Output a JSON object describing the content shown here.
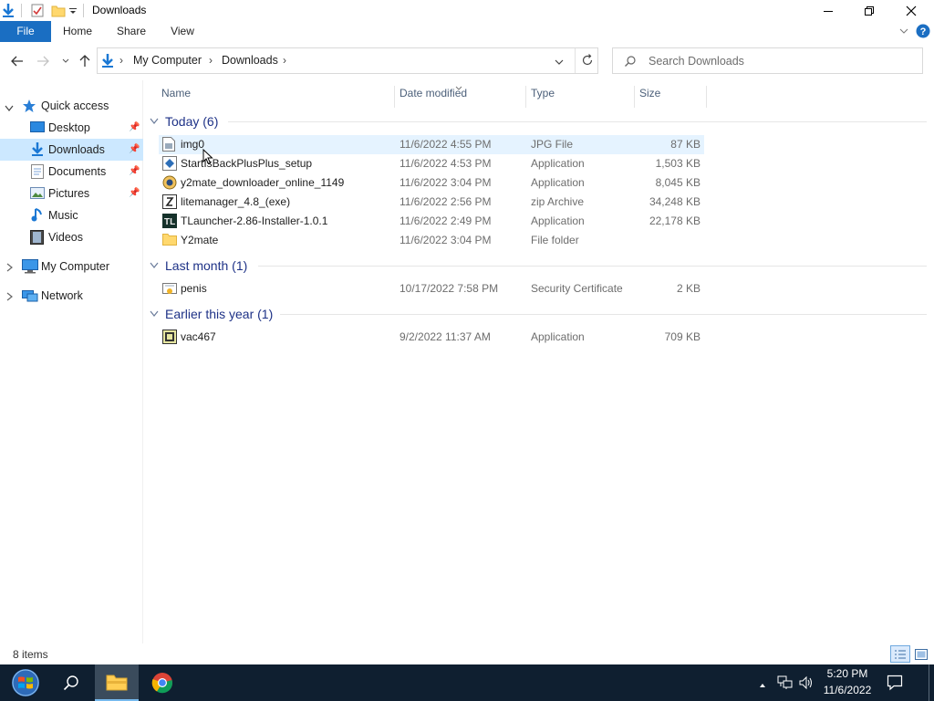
{
  "window": {
    "title": "Downloads"
  },
  "ribbon": {
    "tabs": [
      "File",
      "Home",
      "Share",
      "View"
    ]
  },
  "address": {
    "crumbs": [
      "My Computer",
      "Downloads"
    ],
    "search_placeholder": "Search Downloads"
  },
  "nav": {
    "quick_access": "Quick access",
    "items": [
      "Desktop",
      "Downloads",
      "Documents",
      "Pictures",
      "Music",
      "Videos"
    ],
    "my_computer": "My Computer",
    "network": "Network"
  },
  "columns": [
    "Name",
    "Date modified",
    "Type",
    "Size"
  ],
  "groups": [
    {
      "label": "Today (6)"
    },
    {
      "label": "Last month (1)"
    },
    {
      "label": "Earlier this year (1)"
    }
  ],
  "files": [
    {
      "name": "img0",
      "date": "11/6/2022 4:55 PM",
      "type": "JPG File",
      "size": "87 KB"
    },
    {
      "name": "StartIsBackPlusPlus_setup",
      "date": "11/6/2022 4:53 PM",
      "type": "Application",
      "size": "1,503 KB"
    },
    {
      "name": "y2mate_downloader_online_1149",
      "date": "11/6/2022 3:04 PM",
      "type": "Application",
      "size": "8,045 KB"
    },
    {
      "name": "litemanager_4.8_(exe)",
      "date": "11/6/2022 2:56 PM",
      "type": "zip Archive",
      "size": "34,248 KB"
    },
    {
      "name": "TLauncher-2.86-Installer-1.0.1",
      "date": "11/6/2022 2:49 PM",
      "type": "Application",
      "size": "22,178 KB"
    },
    {
      "name": "Y2mate",
      "date": "11/6/2022 3:04 PM",
      "type": "File folder",
      "size": ""
    },
    {
      "name": "penis",
      "date": "10/17/2022 7:58 PM",
      "type": "Security Certificate",
      "size": "2 KB"
    },
    {
      "name": "vac467",
      "date": "9/2/2022 11:37 AM",
      "type": "Application",
      "size": "709 KB"
    }
  ],
  "status": {
    "count": "8 items"
  },
  "taskbar": {
    "time": "5:20 PM",
    "date": "11/6/2022"
  },
  "colors": {
    "accent": "#1a6ec2",
    "selection": "#cce8ff",
    "group_text": "#1e3287",
    "taskbar": "#0f1f30"
  }
}
